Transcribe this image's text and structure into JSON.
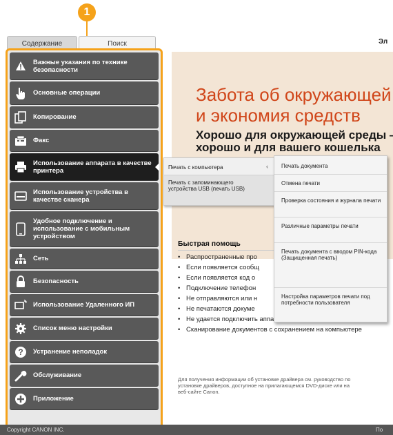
{
  "callout_number": "1",
  "tabs": {
    "contents": "Содержание",
    "search": "Поиск"
  },
  "sidebar": {
    "items": [
      {
        "label": "Важные указания по технике безопасности",
        "icon": "warning-icon"
      },
      {
        "label": "Основные операции",
        "icon": "hand-icon"
      },
      {
        "label": "Копирование",
        "icon": "copy-icon"
      },
      {
        "label": "Факс",
        "icon": "fax-icon"
      },
      {
        "label": "Использование аппарата в качестве принтера",
        "icon": "printer-icon",
        "active": true
      },
      {
        "label": "Использование устройства в качестве сканера",
        "icon": "scanner-icon"
      },
      {
        "label": "Удобное подключение и использование с мобильным устройством",
        "icon": "mobile-icon"
      },
      {
        "label": "Сеть",
        "icon": "network-icon"
      },
      {
        "label": "Безопасность",
        "icon": "lock-icon"
      },
      {
        "label": "Использование Удаленного ИП",
        "icon": "remote-ui-icon"
      },
      {
        "label": "Список меню настройки",
        "icon": "gear-icon"
      },
      {
        "label": "Устранение неполадок",
        "icon": "help-icon"
      },
      {
        "label": "Обслуживание",
        "icon": "wrench-icon"
      },
      {
        "label": "Приложение",
        "icon": "plus-icon"
      }
    ]
  },
  "main": {
    "top_title": "Эл",
    "hero_title_line1": "Забота об окружающей",
    "hero_title_line2": "и экономия средств",
    "hero_sub_line1": "Хорошо для окружающей среды —",
    "hero_sub_line2": "хорошо и для вашего кошелька",
    "quick_help_title": "Быстрая помощь",
    "quick_help_items": [
      "Распространенные про",
      "Если появляется сообщ",
      "Если появляется код о",
      "Подключение телефон",
      "Не отправляются или н",
      "Не печатаются докуме",
      "Не удается подключить аппарат к сетевому компьютеру",
      "Сканирование документов с сохранением на компьютере"
    ],
    "note": "Для получения информации об установке драйвера см. руководство по установке драйверов, доступное на прилагающемся DVD-диске или на веб-сайте Canon."
  },
  "submenu_level1": {
    "items": [
      "Печать с компьютера",
      "Печать с запоминающего устройства USB (печать USB)"
    ],
    "arrow": "‹"
  },
  "submenu_level2": {
    "items": [
      "Печать документа",
      "Отмена печати",
      "Проверка состояния и журнала печати",
      "Различные параметры печати",
      "Печать документа с вводом PIN-кода (Защищенная печать)",
      "Настройка параметров печати под потребности пользователя"
    ]
  },
  "footer": {
    "copyright": "Copyright CANON INC.",
    "right_text": "По"
  },
  "colors": {
    "accent": "#f5a21a",
    "nav_bg": "#595959",
    "nav_active": "#1e1e1e",
    "hero_title": "#d0461a"
  }
}
